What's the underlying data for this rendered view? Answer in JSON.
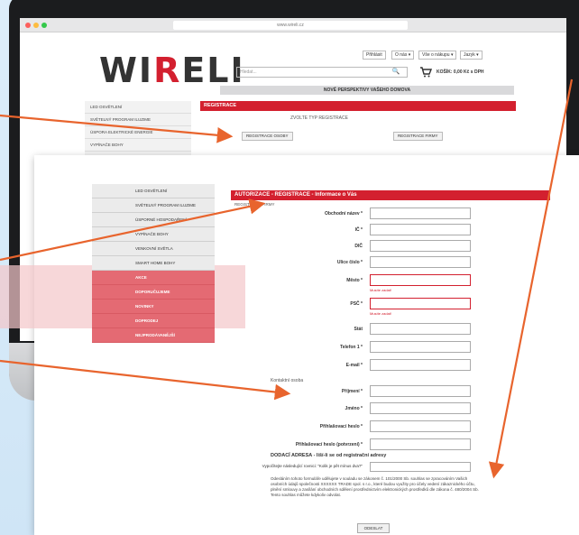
{
  "browser": {
    "url": "www.wireli.cz"
  },
  "site": {
    "logo_left": "WI",
    "logo_mid": "R",
    "logo_right": "ELI",
    "top_links": [
      "Přihlásit",
      "O nás ▾",
      "Vše o nákupu ▾",
      "Jazyk ▾"
    ],
    "search_placeholder": "Hledat...",
    "cart_text": "KOŠÍK: 0,00 Kč s DPH",
    "tagline": "NOVÉ PERSPEKTIVY VAŠEHO DOMOVA"
  },
  "sidebar": {
    "items": [
      "LED osvětlení",
      "Světelný program Iluzime",
      "Úspora elektrické energie",
      "Vypínače bohy",
      "Venkovní světla"
    ]
  },
  "registration": {
    "header": "REGISTRACE",
    "subtitle": "ZVOLTE TYP REGISTRACE",
    "person_button": "REGISTRACE OSOBY",
    "company_button": "REGISTRACE FIRMY"
  },
  "menu": {
    "items": [
      "LED osvětlení",
      "Světelný program Iluzime",
      "Úsporné hospodaření",
      "Vypínače bohy",
      "Venkovní světla",
      "Smart home bohy"
    ],
    "red_items": [
      "Akce",
      "Doporučujeme",
      "Novinky",
      "Doprodej",
      "Nejprodávanější"
    ]
  },
  "form": {
    "header": "AUTORIZACE - REGISTRACE - Informace o Vás",
    "subtitle": "REGISTRACE FIRMY",
    "fields": [
      {
        "label": "Obchodní název *",
        "error": ""
      },
      {
        "label": "IČ *",
        "error": ""
      },
      {
        "label": "DIČ",
        "error": ""
      },
      {
        "label": "Ulice číslo *",
        "error": ""
      },
      {
        "label": "Město *",
        "error": "Musíte zadat!"
      },
      {
        "label": "PSČ *",
        "error": "Musíte zadat!"
      },
      {
        "label": "Stát",
        "error": ""
      },
      {
        "label": "Telefon 1 *",
        "error": ""
      },
      {
        "label": "E-mail *",
        "error": ""
      }
    ],
    "contact_section": "Kontaktní osoba",
    "contact_fields": [
      "Příjmení *",
      "Jméno *",
      "Přihlašovací heslo *",
      "Přihlašovací heslo (potvrzení) *"
    ],
    "captcha_label": "Vypočítejte následující rovnici: \"Kolik je pět mínus dva?\"",
    "delivery_heading": "DODACÍ ADRESA - liší-li se od registrační adresy",
    "consent_text": "Odesláním tohoto formuláře udělujete v souladu se zákonem č. 101/2000 Sb. souhlas se zpracováním Vašich osobních údajů společnosti XXXXXX TRADE spol. s r.o., které budou využity pro účely vedení zákaznického účtu, plnění smlouvy a zasílání obchodních sdělení prostřednictvím elektronických prostředků dle zákona č. 480/2004 Sb. Tento souhlas můžete kdykoliv odvolat.",
    "submit_label": "ODESLAT"
  },
  "colors": {
    "accent_red": "#d3202f",
    "arrow": "#e8642d"
  }
}
